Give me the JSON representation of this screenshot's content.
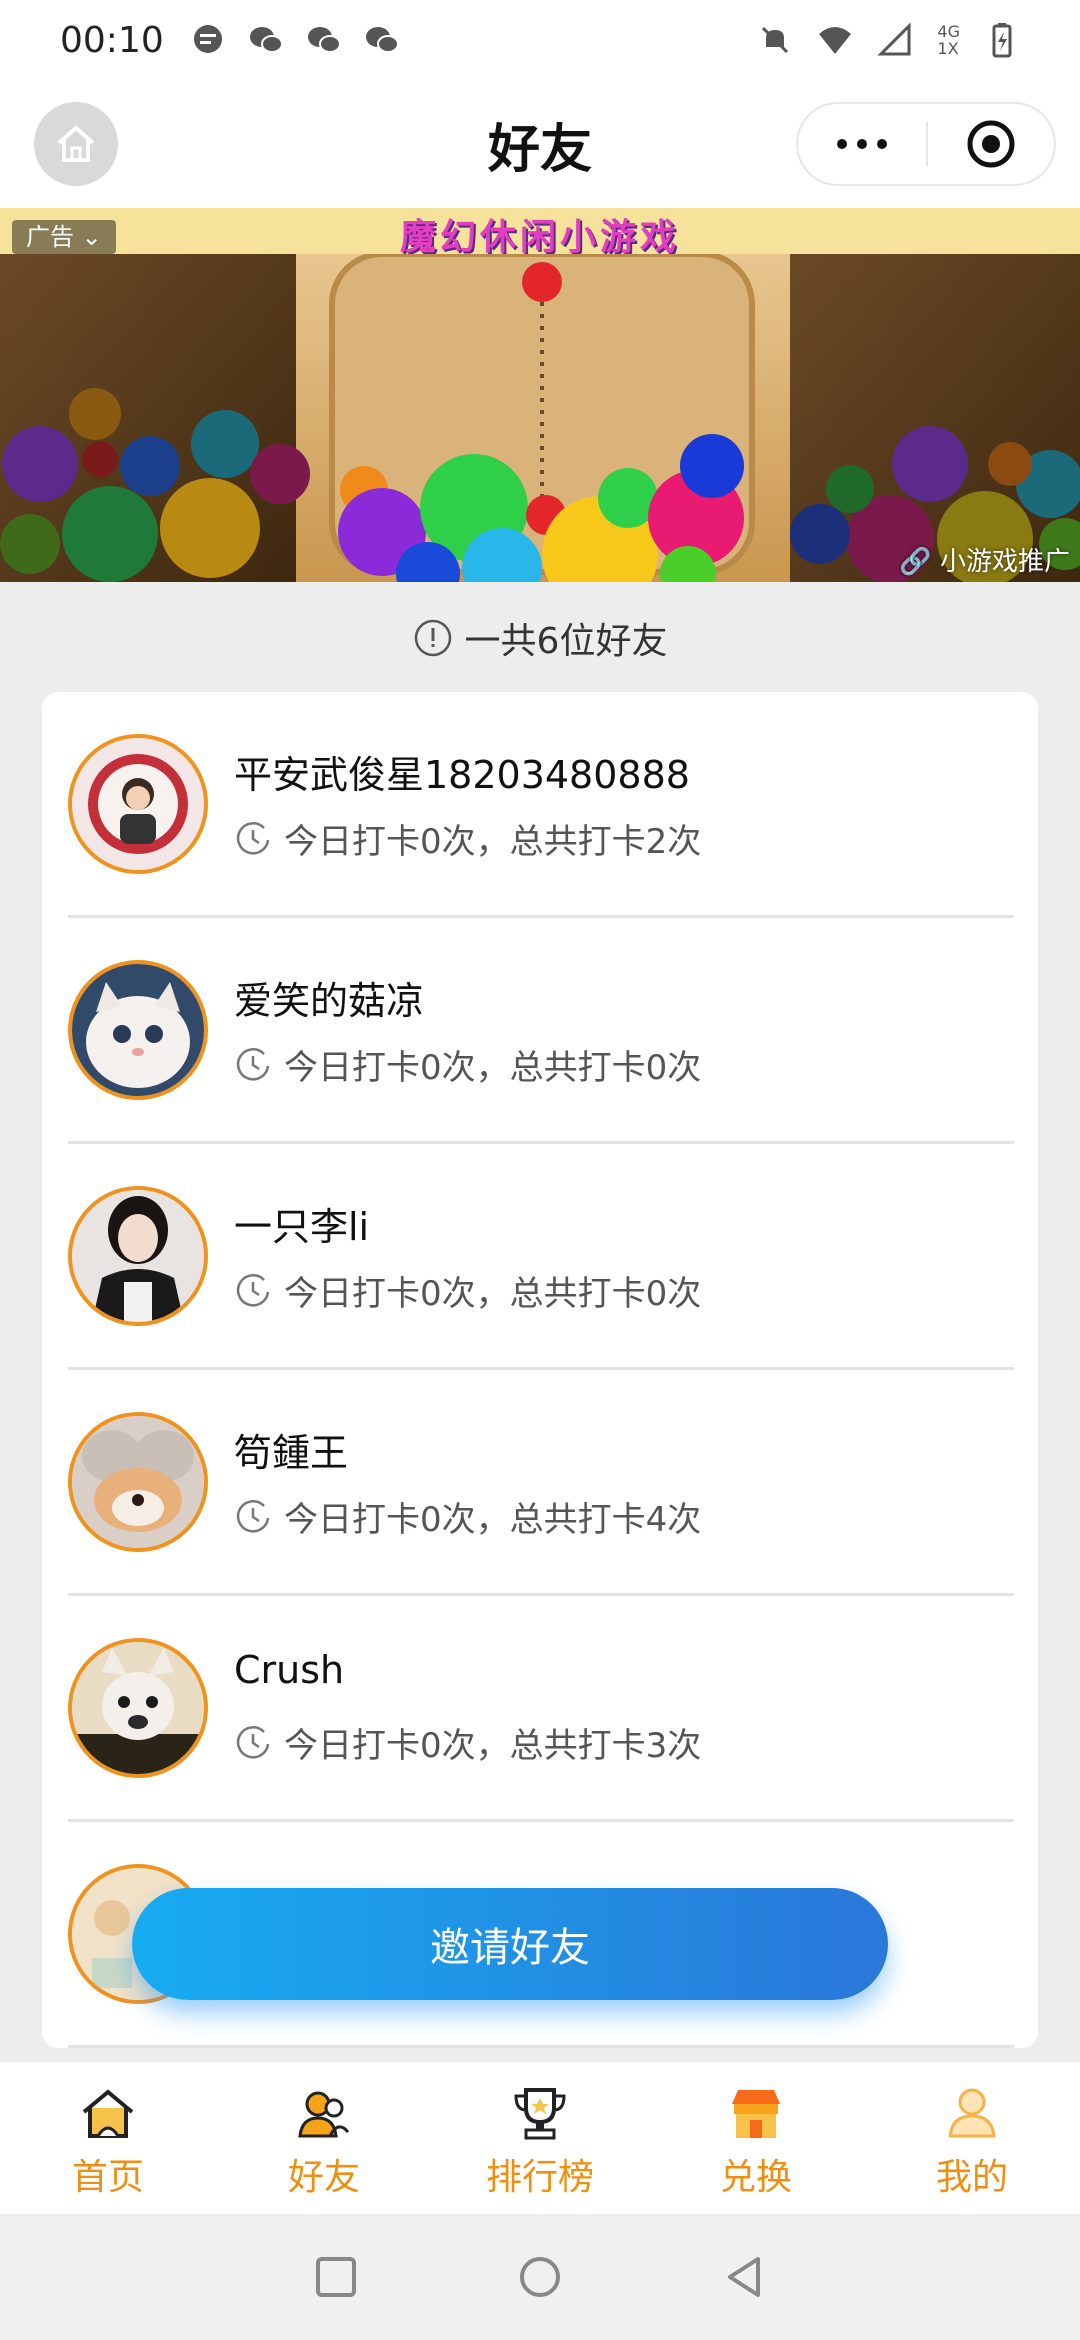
{
  "status_bar": {
    "time": "00:10",
    "network": "4G",
    "network_sub": "1X"
  },
  "nav": {
    "title": "好友"
  },
  "ad": {
    "label": "广告",
    "title": "魔幻休闲小游戏",
    "promo": "小游戏推广"
  },
  "summary": {
    "count_text": "一共6位好友"
  },
  "friends": [
    {
      "name": "平安武俊星18203480888",
      "stats": "今日打卡0次，总共打卡2次"
    },
    {
      "name": "爱笑的菇凉",
      "stats": "今日打卡0次，总共打卡0次"
    },
    {
      "name": "一只李li",
      "stats": "今日打卡0次，总共打卡0次"
    },
    {
      "name": "笱鍾王",
      "stats": "今日打卡0次，总共打卡4次"
    },
    {
      "name": "Crush",
      "stats": "今日打卡0次，总共打卡3次"
    }
  ],
  "invite": {
    "label": "邀请好友"
  },
  "tabs": [
    {
      "label": "首页",
      "icon": "home-icon"
    },
    {
      "label": "好友",
      "icon": "friends-icon"
    },
    {
      "label": "排行榜",
      "icon": "trophy-icon"
    },
    {
      "label": "兑换",
      "icon": "shop-icon"
    },
    {
      "label": "我的",
      "icon": "profile-icon"
    }
  ],
  "colors": {
    "accent": "#ee8f12",
    "avatar_ring": "#f0921e",
    "invite_start": "#17acf2",
    "invite_end": "#2a77d8"
  }
}
